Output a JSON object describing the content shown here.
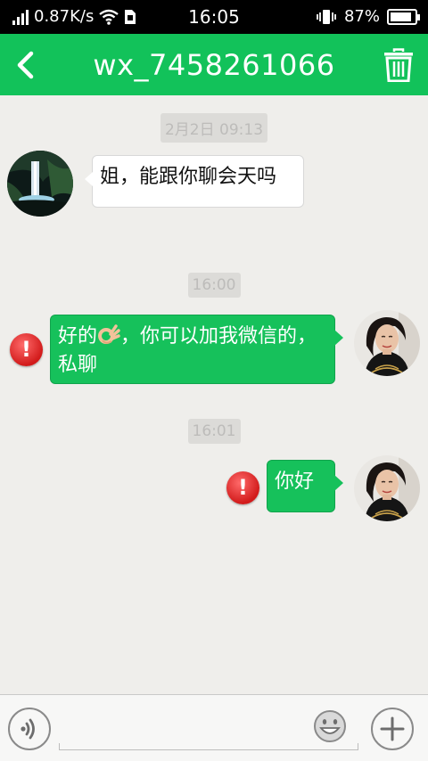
{
  "status_bar": {
    "net_speed": "0.87K/s",
    "time": "16:05",
    "battery_percent": "87%",
    "battery_level": 0.87
  },
  "header": {
    "title": "wx_7458261066",
    "back_icon": "chevron-left-icon",
    "delete_icon": "trash-icon"
  },
  "messages": [
    {
      "timestamp": "2月2日 09:13",
      "direction": "incoming",
      "text": "姐，能跟你聊会天吗"
    },
    {
      "timestamp": "16:00",
      "direction": "outgoing",
      "text_before_emoji": "好的",
      "emoji": "ok-hand-emoji",
      "text_after_emoji": "，你可以加我微信的，私聊",
      "failed": true
    },
    {
      "timestamp": "16:01",
      "direction": "outgoing",
      "text": "你好",
      "failed": true
    }
  ],
  "error_mark": "!",
  "input_bar": {
    "value": "",
    "placeholder": "",
    "voice_icon": "voice-icon",
    "emoji_icon": "smiley-icon",
    "plus_icon": "plus-icon"
  },
  "colors": {
    "brand_green": "#12c25a",
    "bubble_green": "#16c15b",
    "error_red": "#d21b1b",
    "chat_background": "#efeeeb"
  }
}
